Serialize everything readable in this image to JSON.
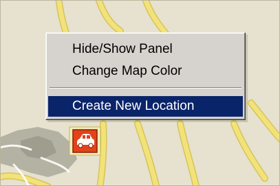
{
  "context_menu": {
    "items": [
      {
        "label": "Hide/Show Panel",
        "selected": false
      },
      {
        "label": "Change Map Color",
        "selected": false
      },
      {
        "label": "Create New Location",
        "selected": true
      }
    ]
  },
  "map": {
    "background_color": "#e6e2cf",
    "road_color": "#f2e27a",
    "road_outline_color": "#d7c35a",
    "park_color": "#aaa99a"
  },
  "marker": {
    "icon": "car-icon",
    "color": "#e2421a"
  }
}
